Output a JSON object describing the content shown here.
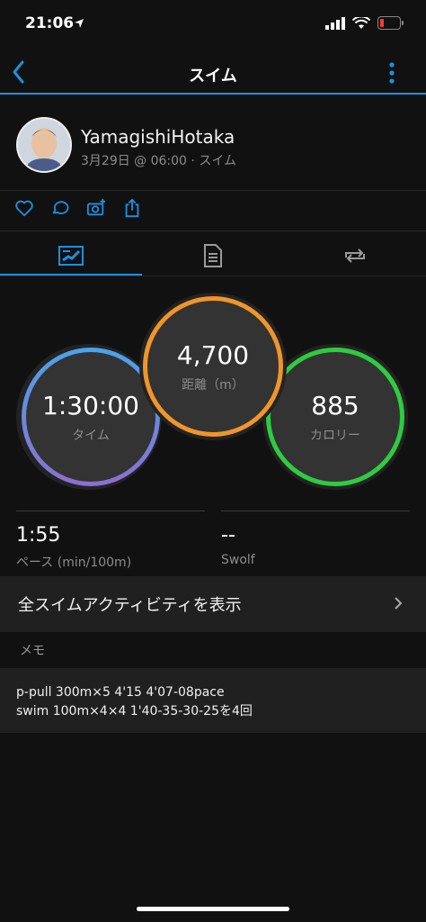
{
  "status": {
    "time": "21:06"
  },
  "nav": {
    "title": "スイム",
    "back_icon": "chevron-left-icon",
    "menu_icon": "more-vertical-icon"
  },
  "profile": {
    "name": "YamagishiHotaka",
    "subtitle": "3月29日 @ 06:00 · スイム"
  },
  "actions": [
    "heart-icon",
    "comment-icon",
    "camera-add-icon",
    "share-icon"
  ],
  "tabs": [
    {
      "icon": "stats-chart-icon",
      "active": true
    },
    {
      "icon": "document-list-icon",
      "active": false
    },
    {
      "icon": "laps-repeat-icon",
      "active": false
    }
  ],
  "metrics": {
    "time": {
      "value": "1:30:00",
      "label": "タイム",
      "color": "#5a8de0"
    },
    "distance": {
      "value": "4,700",
      "label": "距離（m）",
      "color": "#f0952a"
    },
    "calories": {
      "value": "885",
      "label": "カロリー",
      "color": "#2ecc40"
    }
  },
  "stats": {
    "pace": {
      "value": "1:55",
      "label": "ペース (min/100m)"
    },
    "swolf": {
      "value": "--",
      "label": "Swolf"
    }
  },
  "all_activities": {
    "label": "全スイムアクティビティを表示"
  },
  "memo": {
    "heading": "メモ",
    "line1": "p-pull 300m×5 4'15 4'07-08pace",
    "line2": "swim 100m×4×4 1'40-35-30-25を4回"
  },
  "colors": {
    "accent": "#1e8fe0",
    "background": "#111111",
    "panel": "#202020"
  }
}
